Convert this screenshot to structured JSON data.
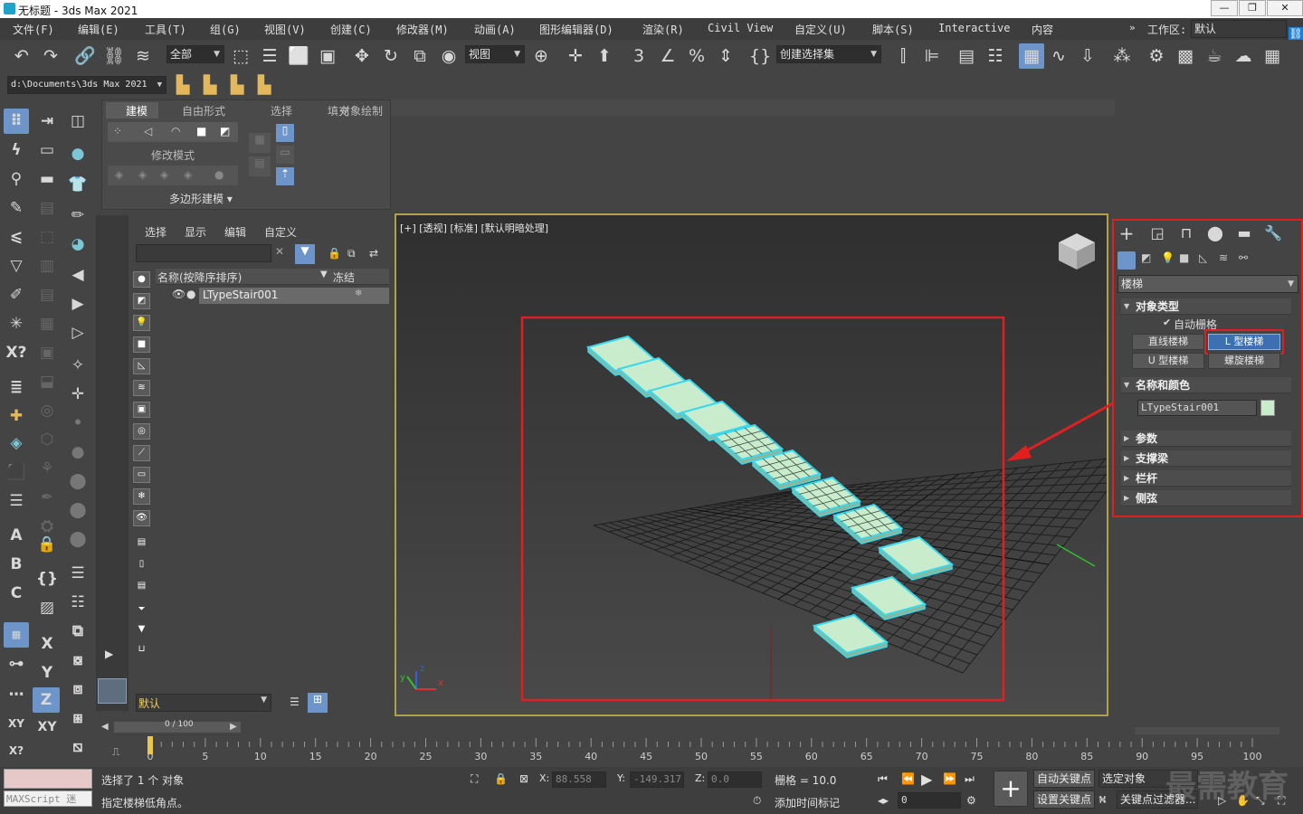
{
  "title_bar": {
    "title": "无标题 - 3ds Max 2021",
    "minimize": "—",
    "restore": "❐",
    "close": "✕"
  },
  "menu": [
    "文件(F)",
    "编辑(E)",
    "工具(T)",
    "组(G)",
    "视图(V)",
    "创建(C)",
    "修改器(M)",
    "动画(A)",
    "图形编辑器(D)",
    "渲染(R)",
    "Civil View",
    "自定义(U)",
    "脚本(S)",
    "Interactive",
    "内容"
  ],
  "workspace": {
    "label": "工作区:",
    "value": "默认"
  },
  "toolbar": {
    "selection_filter": "全部",
    "ref_coord": "视图",
    "named_selection": "创建选择集"
  },
  "toolbar2": {
    "project_path": "d:\\Documents\\3ds Max 2021"
  },
  "ribbon": {
    "tabs": [
      "建模",
      "自由形式",
      "选择",
      "对象绘制",
      "填充"
    ],
    "active_tab": "建模",
    "modify_mode": "修改模式",
    "poly_modeling": "多边形建模 ▾"
  },
  "scene_explorer": {
    "menu": [
      "选择",
      "显示",
      "编辑",
      "自定义"
    ],
    "col_name": "名称(按降序排序)",
    "col_freeze": "冻结",
    "object": "LTypeStair001",
    "layer": "默认",
    "frame": "0 / 100"
  },
  "viewport": {
    "label": "[+] [透视] [标准] [默认明暗处理]",
    "axes": {
      "x": "x",
      "y": "y",
      "z": "z"
    }
  },
  "command_panel": {
    "category": "楼梯",
    "object_type_title": "对象类型",
    "auto_grid": "自动栅格",
    "buttons": [
      "直线楼梯",
      "L 型楼梯",
      "U 型楼梯",
      "螺旋楼梯"
    ],
    "selected_button": "L 型楼梯",
    "name_color_title": "名称和颜色",
    "object_name": "LTypeStair001",
    "object_color": "#c8eccc",
    "rollouts": [
      "参数",
      "支撑梁",
      "栏杆",
      "侧弦"
    ]
  },
  "timeline": {
    "ticks": [
      "0",
      "5",
      "10",
      "15",
      "20",
      "25",
      "30",
      "35",
      "40",
      "45",
      "50",
      "55",
      "60",
      "65",
      "70",
      "75",
      "80",
      "85",
      "90",
      "95",
      "100"
    ]
  },
  "status": {
    "selected": "选择了 1 个 对象",
    "prompt": "指定楼梯低角点。",
    "maxscript": "MAXScript 迷",
    "x_label": "X:",
    "x_value": "88.558",
    "y_label": "Y:",
    "y_value": "-149.317",
    "z_label": "Z:",
    "z_value": "0.0",
    "grid": "栅格 = 10.0",
    "add_time_tag": "添加时间标记",
    "auto_key": "自动关键点",
    "selected_obj": "选定对象",
    "set_key": "设置关键点",
    "key_filters": "关键点过滤器...",
    "frame_value": "0"
  },
  "watermark": "最需教育",
  "accent": {
    "highlight": "#e02020",
    "selected_blue": "#3d6fb3",
    "stair": "#c8eccc",
    "stair_edge": "#38d9ee"
  }
}
